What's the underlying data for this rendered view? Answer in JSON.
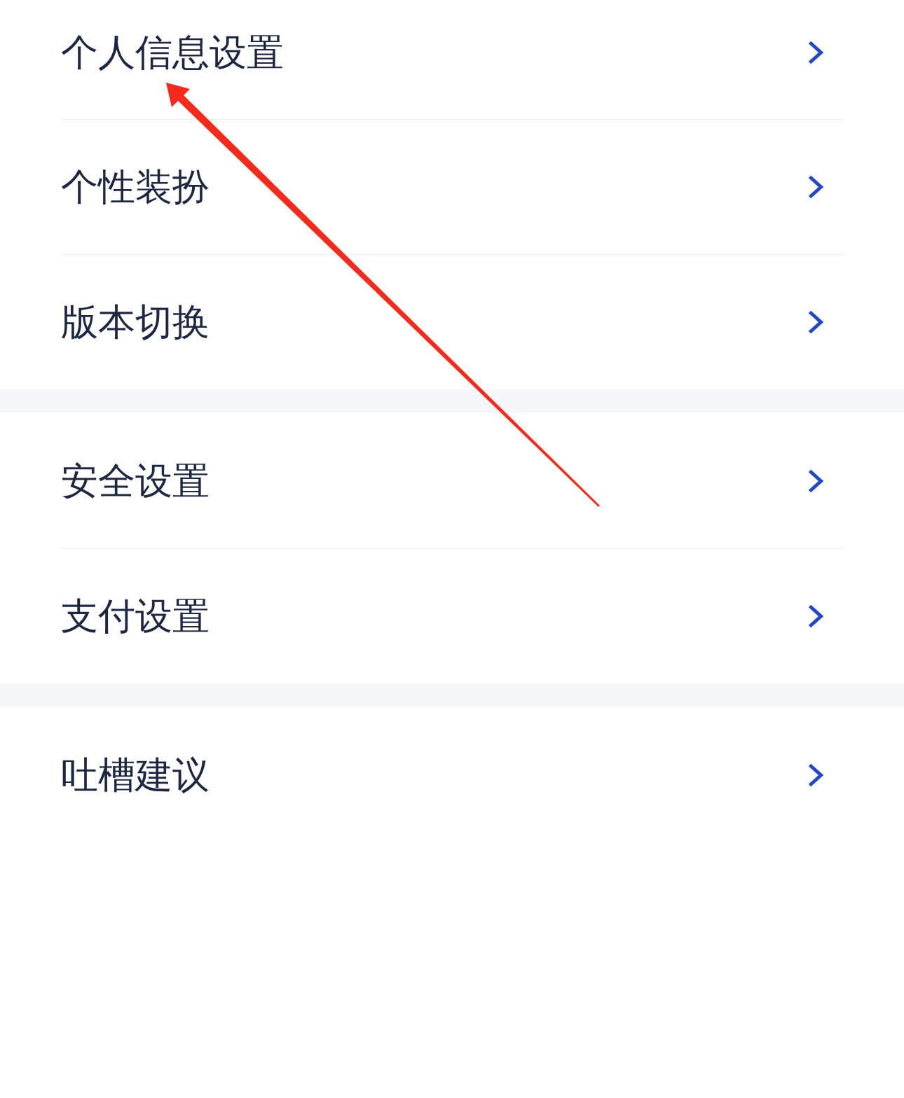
{
  "sections": [
    {
      "items": [
        {
          "label": "个人信息设置"
        },
        {
          "label": "个性装扮"
        },
        {
          "label": "版本切换"
        }
      ]
    },
    {
      "items": [
        {
          "label": "安全设置"
        },
        {
          "label": "支付设置"
        }
      ]
    },
    {
      "items": [
        {
          "label": "吐槽建议"
        }
      ]
    }
  ],
  "annotations": [
    {
      "kind": "arrow"
    }
  ]
}
